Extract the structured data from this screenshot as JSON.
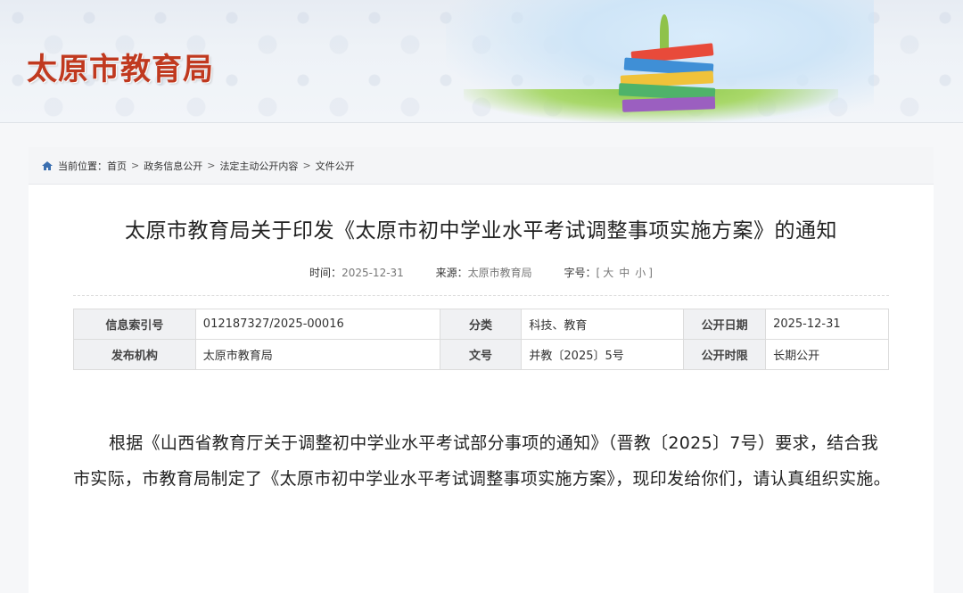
{
  "site": {
    "title": "太原市教育局"
  },
  "breadcrumb": {
    "prefix": "当前位置：",
    "items": [
      "首页",
      "政务信息公开",
      "法定主动公开内容",
      "文件公开"
    ],
    "separator": ">"
  },
  "article": {
    "title": "太原市教育局关于印发《太原市初中学业水平考试调整事项实施方案》的通知",
    "meta": {
      "time_label": "时间：",
      "time_value": "2025-12-31",
      "source_label": "来源：",
      "source_value": "太原市教育局",
      "fontsize_label": "字号：",
      "fontsize_open": "[",
      "fontsize_options": [
        "大",
        "中",
        "小"
      ],
      "fontsize_close": "]"
    },
    "info_table": {
      "rows": [
        {
          "k1": "信息索引号",
          "v1": "012187327/2025-00016",
          "k2": "分类",
          "v2": "科技、教育",
          "k3": "公开日期",
          "v3": "2025-12-31"
        },
        {
          "k1": "发布机构",
          "v1": "太原市教育局",
          "k2": "文号",
          "v2": "并教〔2025〕5号",
          "k3": "公开时限",
          "v3": "长期公开"
        }
      ]
    },
    "body": "根据《山西省教育厅关于调整初中学业水平考试部分事项的通知》（晋教〔2025〕7号）要求，结合我市实际，市教育局制定了《太原市初中学业水平考试调整事项实施方案》，现印发给你们，请认真组织实施。"
  },
  "colors": {
    "title_red": "#c0391f",
    "table_key_bg": "#f0f1f3",
    "breadcrumb_bg": "#f4f5f7"
  },
  "icons": {
    "home": "home-icon"
  }
}
